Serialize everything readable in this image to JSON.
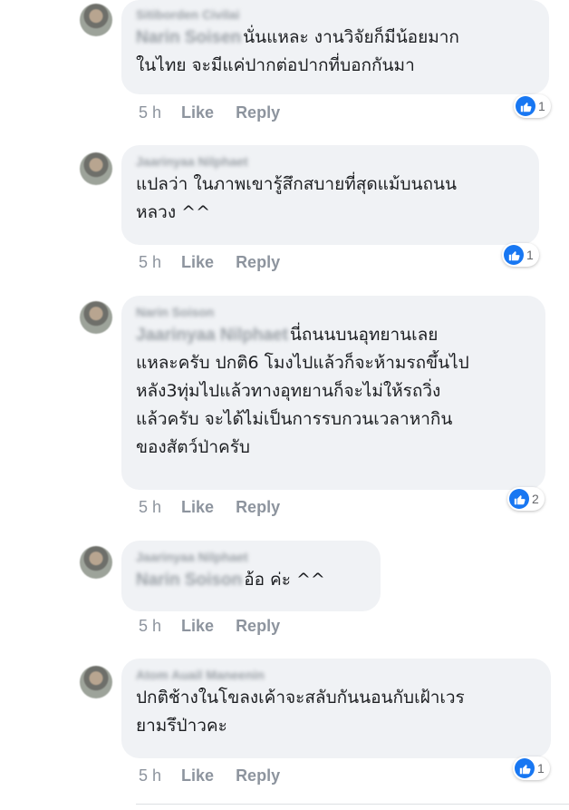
{
  "comments": [
    {
      "author": "Sitiborden Civilai",
      "mention": "Narin Soisen",
      "text_lines": [
        "นั่นแหละ งานวิจัยก็มีน้อยมาก",
        "ในไทย จะมีแค่ปากต่อปากที่บอกกันมา"
      ],
      "time": "5 h",
      "like": "Like",
      "reply": "Reply",
      "reactions": "1"
    },
    {
      "author": "Jaarinyaa Nilphaet",
      "mention": "",
      "text_lines": [
        "แปลว่า ในภาพเขารู้สึกสบายที่สุดแม้บนถนน",
        "หลวง  ^^"
      ],
      "time": "5 h",
      "like": "Like",
      "reply": "Reply",
      "reactions": "1"
    },
    {
      "author": "Narin Soison",
      "mention": "Jaarinyaa Nilphaet",
      "text_lines": [
        "นี่ถนนบนอุทยานเลย",
        "แหละครับ ปกติ6 โมงไปแล้วก็จะห้ามรถขึ้นไป",
        "หลัง3ทุ่มไปแล้วทางอุทยานก็จะไม่ให้รถวิ่ง",
        "แล้วครับ จะได้ไม่เป็นการรบกวนเวลาหากิน",
        "ของสัตว์ป่าครับ"
      ],
      "time": "5 h",
      "like": "Like",
      "reply": "Reply",
      "reactions": "2"
    },
    {
      "author": "Jaarinyaa Nilphaet",
      "mention": "Narin Soison",
      "text_lines": [
        "อ้อ  ค่ะ  ^^"
      ],
      "time": "5 h",
      "like": "Like",
      "reply": "Reply",
      "reactions": ""
    },
    {
      "author": "Atom Auail Maneenin",
      "mention": "",
      "text_lines": [
        "ปกติช้างในโขลงเค้าจะสลับกันนอนกับเฝ้าเวร",
        "ยามรึป่าวคะ"
      ],
      "time": "5 h",
      "like": "Like",
      "reply": "Reply",
      "reactions": "1"
    }
  ],
  "colors": {
    "bubble": "#f0f2f5",
    "like_blue": "#1877f2",
    "meta_gray": "#8d949e"
  },
  "icons": {
    "reaction": "thumbs-up-icon"
  }
}
